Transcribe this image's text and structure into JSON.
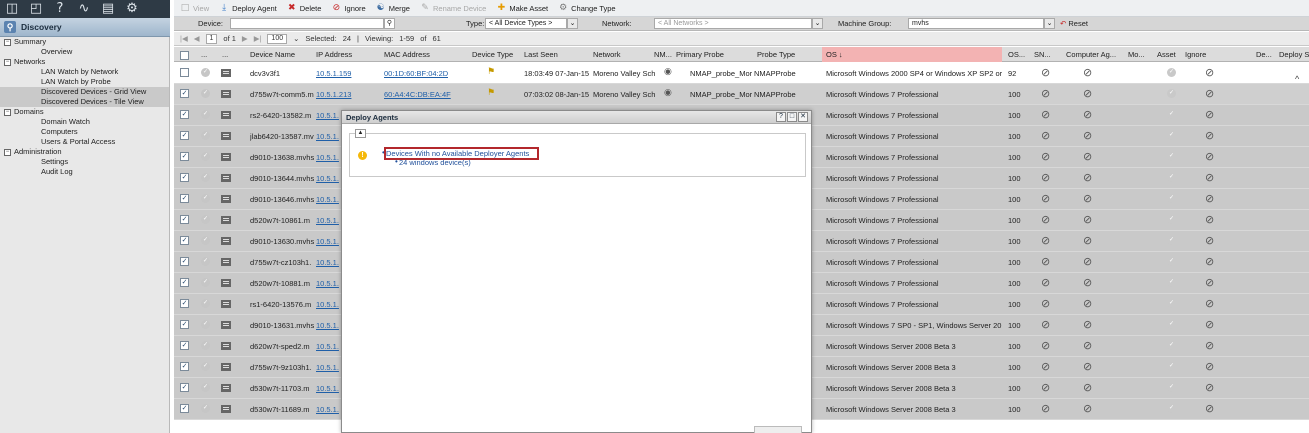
{
  "topicons": [
    "grid-icon",
    "book-icon",
    "help-icon",
    "chart-icon",
    "clipboard-icon",
    "settings-icon"
  ],
  "nav": {
    "title": "Discovery",
    "groups": [
      {
        "label": "Summary",
        "items": [
          {
            "label": "Overview",
            "selected": false
          }
        ]
      },
      {
        "label": "Networks",
        "items": [
          {
            "label": "LAN Watch by Network",
            "selected": false
          },
          {
            "label": "LAN Watch by Probe",
            "selected": false
          },
          {
            "label": "Discovered Devices - Grid View",
            "selected": true
          },
          {
            "label": "Discovered Devices - Tile View",
            "selected": false
          }
        ]
      },
      {
        "label": "Domains",
        "items": [
          {
            "label": "Domain Watch",
            "selected": false
          },
          {
            "label": "Computers",
            "selected": false
          },
          {
            "label": "Users & Portal Access",
            "selected": false
          }
        ]
      },
      {
        "label": "Administration",
        "items": [
          {
            "label": "Settings",
            "selected": false
          },
          {
            "label": "Audit Log",
            "selected": false
          }
        ]
      }
    ]
  },
  "toolbar": {
    "view": "View",
    "deploy_agent": "Deploy Agent",
    "delete": "Delete",
    "ignore": "Ignore",
    "merge": "Merge",
    "rename_device": "Rename Device",
    "make_asset": "Make Asset",
    "change_type": "Change Type"
  },
  "filters": {
    "device_label": "Device:",
    "device_value": "",
    "type_label": "Type:",
    "type_value": "< All Device Types >",
    "network_label": "Network:",
    "network_value": "< All Networks >",
    "group_label": "Machine Group:",
    "group_value": "mvhs",
    "reset": "Reset"
  },
  "pager": {
    "page": "1",
    "of": "of 1",
    "page_size": "100",
    "selected_label": "Selected:",
    "selected": "24",
    "viewing_label": "Viewing:",
    "viewing": "1-59",
    "viewing_of": "of",
    "total": "61"
  },
  "columns": {
    "dots": "...",
    "dots2": "...",
    "device_name": "Device Name",
    "ip": "IP Address",
    "mac": "MAC Address",
    "device_type": "Device Type",
    "last_seen": "Last Seen",
    "network": "Network",
    "nm": "NM...",
    "primary_probe": "Primary Probe",
    "probe_type": "Probe Type",
    "os": "OS ↓",
    "os_short": "OS...",
    "sn": "SN...",
    "computer_agent": "Computer Ag...",
    "mo": "Mo...",
    "asset": "Asset",
    "ignore": "Ignore",
    "de": "De...",
    "deploy_st": "Deploy St"
  },
  "rows": [
    {
      "name": "dcv3v3f1",
      "ip": "10.5.1.159",
      "mac": "00:1D:60:BF:04:2D",
      "last_seen": "18:03:49 07-Jan-15",
      "network": "Moreno Valley Sch",
      "probe": "NMAP_probe_Mor",
      "probe_type": "NMAPProbe",
      "os": "Microsoft Windows 2000 SP4 or Windows XP SP2 or",
      "os_score": "92",
      "checked": false
    },
    {
      "name": "d755w7t-comm5.m",
      "ip": "10.5.1.213",
      "mac": "60:A4:4C:DB:EA:4F",
      "last_seen": "07:03:02 08-Jan-15",
      "network": "Moreno Valley Sch",
      "probe": "NMAP_probe_Mor",
      "probe_type": "NMAPProbe",
      "os": "Microsoft Windows 7 Professional",
      "os_score": "100",
      "checked": true
    },
    {
      "name": "rs2-6420-13582.m",
      "ip": "10.5.1.",
      "os": "Microsoft Windows 7 Professional",
      "os_score": "100",
      "checked": true
    },
    {
      "name": "jlab6420-13587.mv",
      "ip": "10.5.1.",
      "os": "Microsoft Windows 7 Professional",
      "os_score": "100",
      "checked": true
    },
    {
      "name": "d9010-13638.mvhs",
      "ip": "10.5.1.",
      "os": "Microsoft Windows 7 Professional",
      "os_score": "100",
      "checked": true
    },
    {
      "name": "d9010-13644.mvhs",
      "ip": "10.5.1.",
      "os": "Microsoft Windows 7 Professional",
      "os_score": "100",
      "checked": true
    },
    {
      "name": "d9010-13646.mvhs",
      "ip": "10.5.1.",
      "os": "Microsoft Windows 7 Professional",
      "os_score": "100",
      "checked": true
    },
    {
      "name": "d520w7t-10861.m",
      "ip": "10.5.1.",
      "os": "Microsoft Windows 7 Professional",
      "os_score": "100",
      "checked": true
    },
    {
      "name": "d9010-13630.mvhs",
      "ip": "10.5.1.",
      "os": "Microsoft Windows 7 Professional",
      "os_score": "100",
      "checked": true
    },
    {
      "name": "d755w7t-cz103h1.",
      "ip": "10.5.1.",
      "os": "Microsoft Windows 7 Professional",
      "os_score": "100",
      "checked": true
    },
    {
      "name": "d520w7t-10881.m",
      "ip": "10.5.1.",
      "os": "Microsoft Windows 7 Professional",
      "os_score": "100",
      "checked": true
    },
    {
      "name": "rs1-6420-13576.m",
      "ip": "10.5.1.",
      "os": "Microsoft Windows 7 Professional",
      "os_score": "100",
      "checked": true
    },
    {
      "name": "d9010-13631.mvhs",
      "ip": "10.5.1.",
      "os": "Microsoft Windows 7 SP0 - SP1, Windows Server 20",
      "os_score": "100",
      "checked": true
    },
    {
      "name": "d620w7t-sped2.m",
      "ip": "10.5.1.",
      "os": "Microsoft Windows Server 2008 Beta 3",
      "os_score": "100",
      "checked": true
    },
    {
      "name": "d755w7t-9z103h1.",
      "ip": "10.5.1.",
      "os": "Microsoft Windows Server 2008 Beta 3",
      "os_score": "100",
      "checked": true
    },
    {
      "name": "d530w7t-11703.m",
      "ip": "10.5.1.",
      "os": "Microsoft Windows Server 2008 Beta 3",
      "os_score": "100",
      "checked": true
    },
    {
      "name": "d530w7t-11689.m",
      "ip": "10.5.1.",
      "os": "Microsoft Windows Server 2008 Beta 3",
      "os_score": "100",
      "checked": true
    }
  ],
  "modal": {
    "title": "Deploy Agents",
    "warning_title": "Devices With no Available Deployer Agents",
    "warning_detail": "24 windows device(s)"
  },
  "colors": {
    "nav_bg": "#e8e8e8",
    "os_header": "#f3b3b3",
    "link": "#1f5fa8",
    "highlight_border": "#b3282c",
    "warning": "#f5b80a"
  }
}
